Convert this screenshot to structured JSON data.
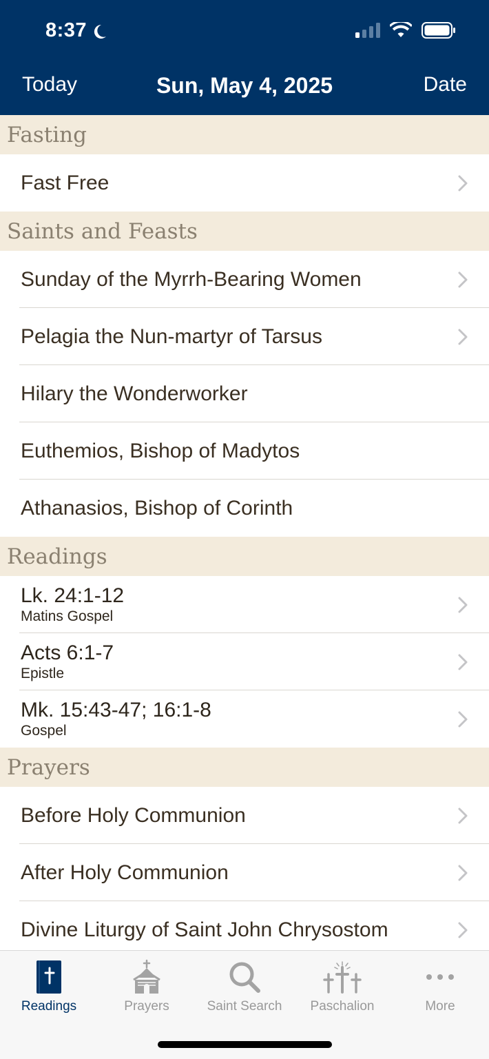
{
  "status_bar": {
    "time": "8:37"
  },
  "nav": {
    "left": "Today",
    "title": "Sun, May 4, 2025",
    "right": "Date"
  },
  "sections": {
    "fasting": {
      "title": "Fasting",
      "items": [
        {
          "label": "Fast Free"
        }
      ]
    },
    "saints": {
      "title": "Saints and Feasts",
      "items": [
        {
          "label": "Sunday of the Myrrh-Bearing Women"
        },
        {
          "label": "Pelagia the Nun-martyr of Tarsus"
        },
        {
          "label": "Hilary the Wonderworker"
        },
        {
          "label": "Euthemios, Bishop of Madytos"
        },
        {
          "label": "Athanasios, Bishop of Corinth"
        }
      ]
    },
    "readings": {
      "title": "Readings",
      "items": [
        {
          "ref": "Lk. 24:1-12",
          "type": "Matins Gospel"
        },
        {
          "ref": "Acts 6:1-7",
          "type": "Epistle"
        },
        {
          "ref": "Mk. 15:43-47; 16:1-8",
          "type": "Gospel"
        }
      ]
    },
    "prayers": {
      "title": "Prayers",
      "items": [
        {
          "label": "Before Holy Communion"
        },
        {
          "label": "After Holy Communion"
        },
        {
          "label": "Divine Liturgy of Saint John Chrysostom"
        }
      ]
    }
  },
  "tabs": [
    {
      "label": "Readings",
      "icon": "bible-icon",
      "active": true
    },
    {
      "label": "Prayers",
      "icon": "church-icon",
      "active": false
    },
    {
      "label": "Saint Search",
      "icon": "search-icon",
      "active": false
    },
    {
      "label": "Paschalion",
      "icon": "three-crosses-icon",
      "active": false
    },
    {
      "label": "More",
      "icon": "ellipsis-icon",
      "active": false
    }
  ],
  "colors": {
    "nav_bar": "#003366",
    "section_bg": "#f3ebdc",
    "section_text": "#8a8070",
    "active_tab": "#003366",
    "inactive_tab": "#999999"
  }
}
